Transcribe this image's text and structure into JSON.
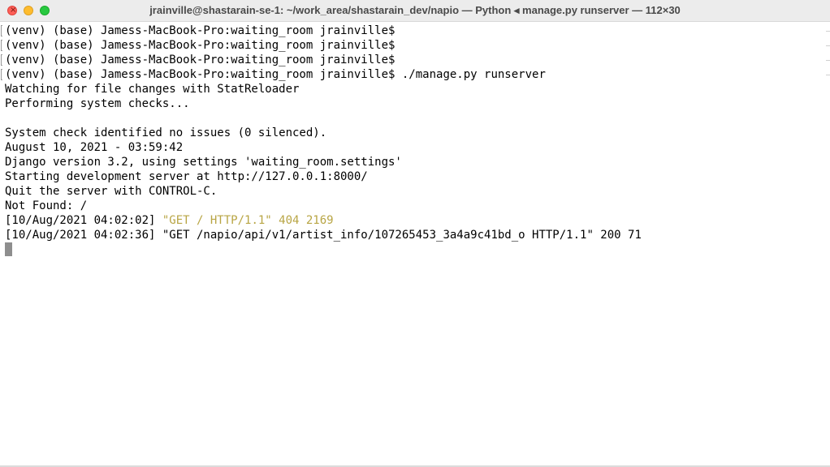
{
  "window": {
    "title": "jrainville@shastarain-se-1: ~/work_area/shastarain_dev/napio — Python ◂ manage.py runserver — 112×30",
    "close_glyph": "×"
  },
  "terminal": {
    "lines": [
      {
        "text": "(venv) (base) Jamess-MacBook-Pro:waiting_room jrainville$ ",
        "marked": true
      },
      {
        "text": "(venv) (base) Jamess-MacBook-Pro:waiting_room jrainville$ ",
        "marked": true
      },
      {
        "text": "(venv) (base) Jamess-MacBook-Pro:waiting_room jrainville$ ",
        "marked": true
      },
      {
        "text": "(venv) (base) Jamess-MacBook-Pro:waiting_room jrainville$ ./manage.py runserver",
        "marked": true
      },
      {
        "text": "Watching for file changes with StatReloader"
      },
      {
        "text": "Performing system checks..."
      },
      {
        "text": ""
      },
      {
        "text": "System check identified no issues (0 silenced)."
      },
      {
        "text": "August 10, 2021 - 03:59:42"
      },
      {
        "text": "Django version 3.2, using settings 'waiting_room.settings'"
      },
      {
        "text": "Starting development server at http://127.0.0.1:8000/"
      },
      {
        "text": "Quit the server with CONTROL-C."
      },
      {
        "text": "Not Found: /"
      },
      {
        "text_prefix": "[10/Aug/2021 04:02:02] ",
        "text_highlight": "\"GET / HTTP/1.1\" 404 2169",
        "highlight_color": "#b8a544"
      },
      {
        "text": "[10/Aug/2021 04:02:36] \"GET /napio/api/v1/artist_info/107265453_3a4a9c41bd_o HTTP/1.1\" 200 71"
      }
    ]
  },
  "colors": {
    "text": "#000000",
    "warning_yellow": "#b8a544",
    "cursor": "#8e8e8e"
  }
}
